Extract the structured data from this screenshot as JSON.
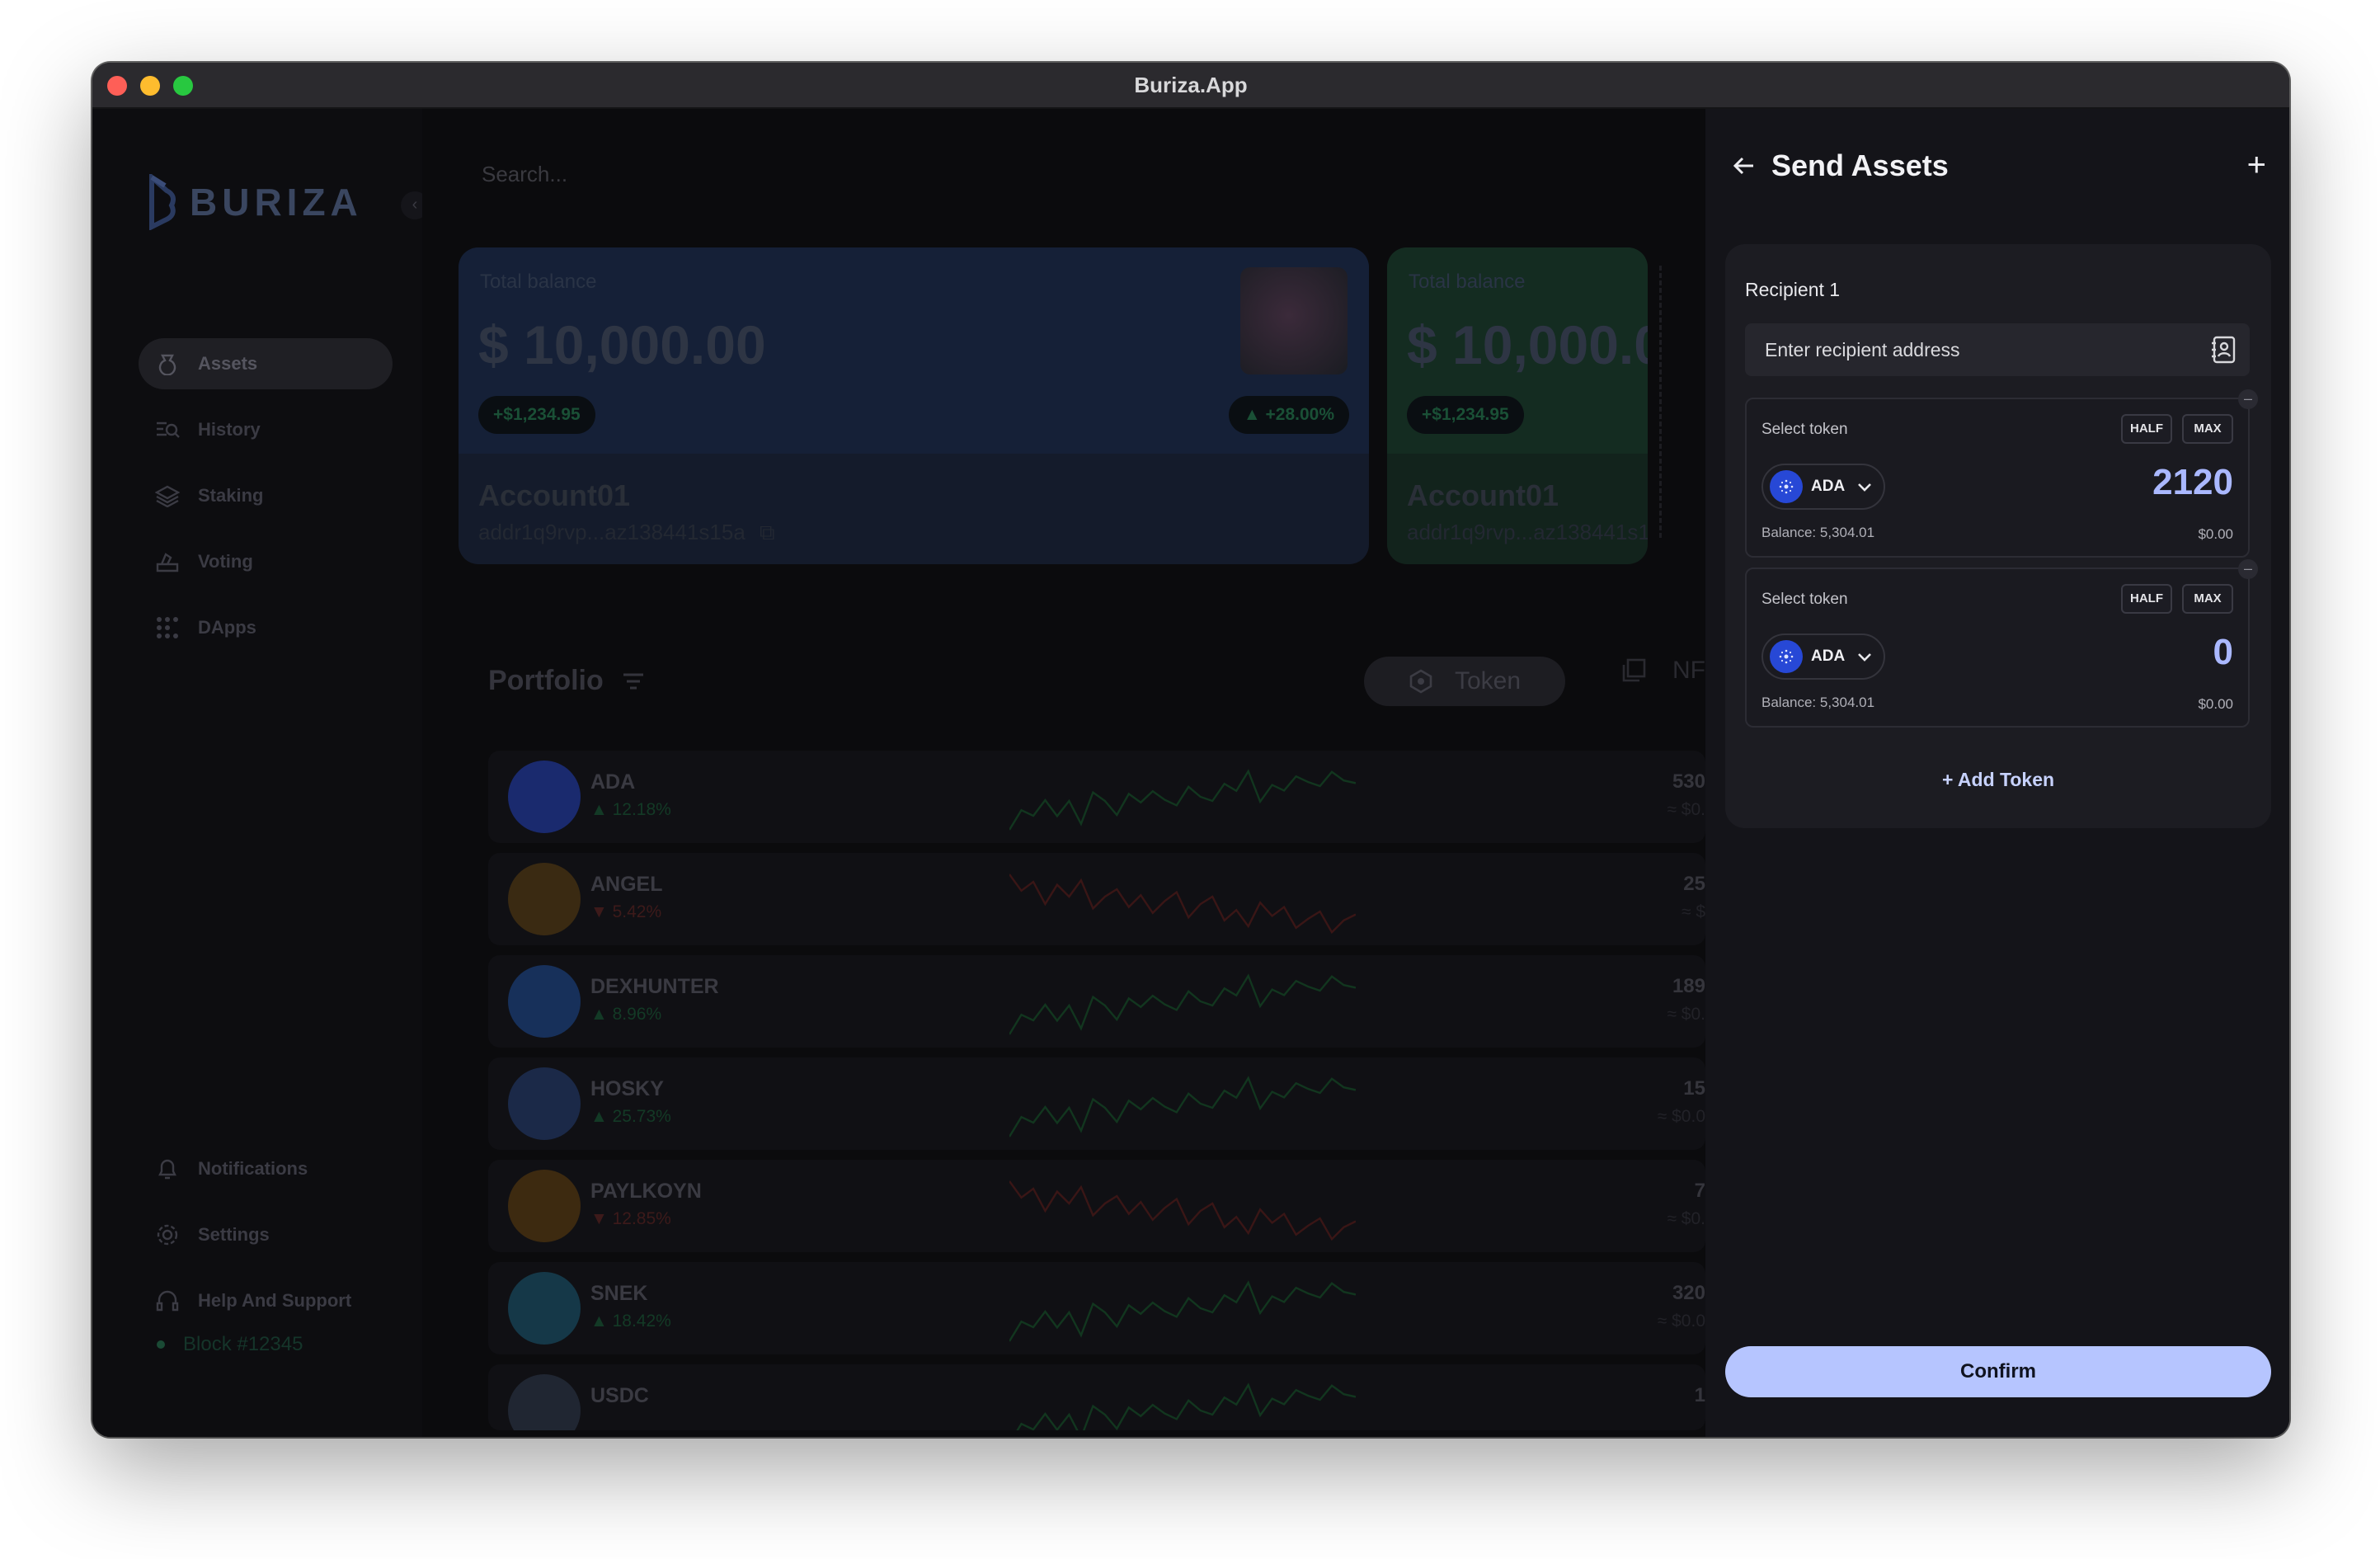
{
  "window": {
    "title": "Buriza.App"
  },
  "sidebar": {
    "brand": "BURIZA",
    "nav": [
      {
        "label": "Assets",
        "icon": "assets-icon"
      },
      {
        "label": "History",
        "icon": "history-icon"
      },
      {
        "label": "Staking",
        "icon": "staking-icon"
      },
      {
        "label": "Voting",
        "icon": "voting-icon"
      },
      {
        "label": "DApps",
        "icon": "dapps-icon"
      }
    ],
    "bottom_nav": [
      {
        "label": "Notifications",
        "icon": "bell-icon"
      },
      {
        "label": "Settings",
        "icon": "gear-icon"
      },
      {
        "label": "Help And Support",
        "icon": "headset-icon"
      }
    ],
    "block": "Block #12345"
  },
  "main": {
    "search_placeholder": "Search...",
    "cards": [
      {
        "label": "Total balance",
        "amount": "$ 10,000.00",
        "change": "+$1,234.95",
        "percent": "▲ +28.00%",
        "account": "Account01",
        "address": "addr1q9rvp...az138441s15a"
      },
      {
        "label": "Total balance",
        "amount": "$ 10,000.0",
        "change": "+$1,234.95",
        "account": "Account01",
        "address": "addr1q9rvp...az138441s1"
      }
    ],
    "portfolio": {
      "title": "Portfolio",
      "tab_token": "Token",
      "tab_nft": "NF",
      "rows": [
        {
          "name": "ADA",
          "change": "▲ 12.18%",
          "trend": "up",
          "amount": "530",
          "usd": "≈ $0.",
          "color": "#1a2a6e"
        },
        {
          "name": "ANGEL",
          "change": "▼ 5.42%",
          "trend": "down",
          "amount": "25",
          "usd": "≈ $",
          "color": "#3a2a12"
        },
        {
          "name": "DEXHUNTER",
          "change": "▲ 8.96%",
          "trend": "up",
          "amount": "189",
          "usd": "≈ $0.",
          "color": "#17305a"
        },
        {
          "name": "HOSKY",
          "change": "▲ 25.73%",
          "trend": "up",
          "amount": "15",
          "usd": "≈ $0.0",
          "color": "#1b2948"
        },
        {
          "name": "PAYLKOYN",
          "change": "▼ 12.85%",
          "trend": "down",
          "amount": "7",
          "usd": "≈ $0.",
          "color": "#3d2a10"
        },
        {
          "name": "SNEK",
          "change": "▲ 18.42%",
          "trend": "up",
          "amount": "320",
          "usd": "≈ $0.0",
          "color": "#153848"
        },
        {
          "name": "USDC",
          "change": "",
          "trend": "up",
          "amount": "1",
          "usd": "",
          "color": "#202632"
        }
      ]
    }
  },
  "send_panel": {
    "title": "Send Assets",
    "recipient_label": "Recipient 1",
    "address_placeholder": "Enter recipient address",
    "tokens": [
      {
        "label": "Select token",
        "half": "HALF",
        "max": "MAX",
        "symbol": "ADA",
        "amount": "2120",
        "balance": "Balance: 5,304.01",
        "usd": "$0.00"
      },
      {
        "label": "Select token",
        "half": "HALF",
        "max": "MAX",
        "symbol": "ADA",
        "amount": "0",
        "balance": "Balance: 5,304.01",
        "usd": "$0.00"
      }
    ],
    "add_token": "+ Add Token",
    "confirm": "Confirm"
  }
}
